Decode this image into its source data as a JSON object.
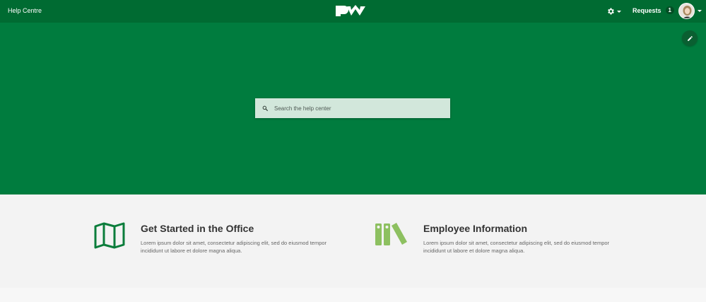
{
  "header": {
    "title": "Help Centre",
    "logo_icon": "pw-logo-icon",
    "settings_icon": "gear-icon",
    "requests_label": "Requests",
    "requests_count": "1",
    "avatar_icon": "user-avatar"
  },
  "hero": {
    "edit_icon": "pencil-icon",
    "search": {
      "placeholder": "Search the help center",
      "icon": "search-icon"
    }
  },
  "categories": [
    {
      "title": "Get Started in the Office",
      "description": "Lorem ipsum dolor sit amet, consectetur adipiscing elit, sed do eiusmod tempor incididunt ut labore et dolore magna aliqua.",
      "icon": "map-icon"
    },
    {
      "title": "Employee Information",
      "description": "Lorem ipsum dolor sit amet, consectetur adipiscing elit, sed do eiusmod tempor incididunt ut labore et dolore magna aliqua.",
      "icon": "binders-icon"
    }
  ],
  "colors": {
    "header_bg": "#006b32",
    "hero_bg": "#007c3e",
    "search_bg": "#d2e7db",
    "map_icon": "#0b7d3b",
    "binders_icon": "#8dc060"
  }
}
